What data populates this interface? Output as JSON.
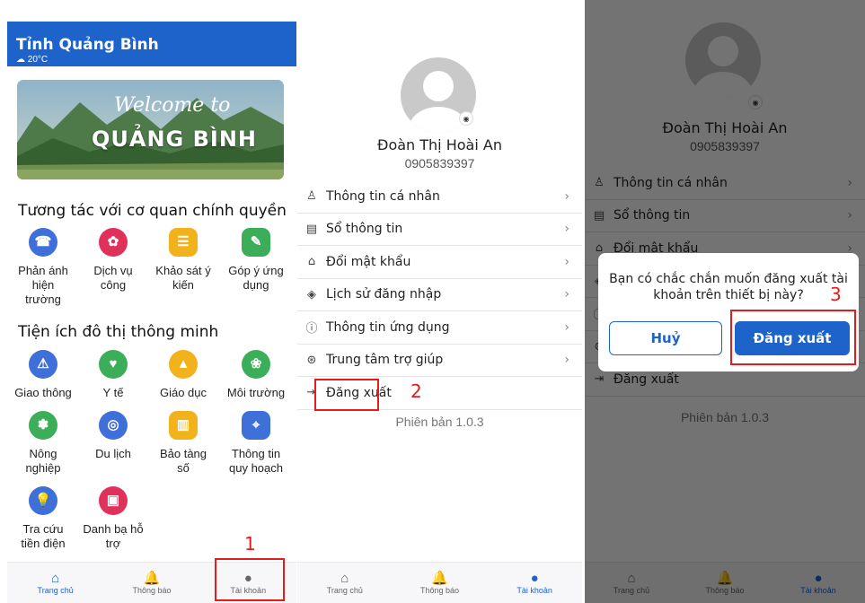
{
  "screen1": {
    "header_title": "Tỉnh Quảng Bình",
    "weather": "20°C",
    "banner_welcome": "Welcome to",
    "banner_place": "QUẢNG BÌNH",
    "section1_title": "Tương tác với cơ quan chính quyền",
    "section1_items": [
      {
        "label": "Phản ánh hiện trường",
        "icon": "megaphone-icon",
        "color": "#3f6fd8"
      },
      {
        "label": "Dịch vụ công",
        "icon": "public-service-icon",
        "color": "#e0315a"
      },
      {
        "label": "Khảo sát ý kiến",
        "icon": "survey-icon",
        "color": "#f2b21c"
      },
      {
        "label": "Góp ý ứng dụng",
        "icon": "feedback-icon",
        "color": "#3cae5a"
      }
    ],
    "section2_title": "Tiện ích đô thị thông minh",
    "section2_items": [
      {
        "label": "Giao thông",
        "icon": "traffic-icon",
        "color": "#3f6fd8"
      },
      {
        "label": "Y tế",
        "icon": "health-icon",
        "color": "#3cae5a"
      },
      {
        "label": "Giáo dục",
        "icon": "education-icon",
        "color": "#f2b21c"
      },
      {
        "label": "Môi trường",
        "icon": "environment-icon",
        "color": "#3cae5a"
      },
      {
        "label": "Nông nghiệp",
        "icon": "agriculture-icon",
        "color": "#3cae5a"
      },
      {
        "label": "Du lịch",
        "icon": "travel-icon",
        "color": "#3f6fd8"
      },
      {
        "label": "Bảo tàng số",
        "icon": "museum-icon",
        "color": "#f2b21c"
      },
      {
        "label": "Thông tin quy hoạch",
        "icon": "map-icon",
        "color": "#3f6fd8"
      },
      {
        "label": "Tra cứu tiền điện",
        "icon": "electricity-icon",
        "color": "#3f6fd8"
      },
      {
        "label": "Danh bạ hỗ trợ",
        "icon": "contacts-icon",
        "color": "#e0315a"
      }
    ],
    "step_number": "1"
  },
  "nav": {
    "home": "Trang chủ",
    "notifications": "Thông báo",
    "account": "Tài khoản"
  },
  "profile": {
    "name": "Đoàn Thị Hoài An",
    "phone": "0905839397",
    "menu": [
      "Thông tin cá nhân",
      "Sổ thông tin",
      "Đổi mật khẩu",
      "Lịch sử đăng nhập",
      "Thông tin ứng dụng",
      "Trung tâm trợ giúp"
    ],
    "logout": "Đăng xuất",
    "version": "Phiên bản 1.0.3",
    "step_number": "2"
  },
  "dialog": {
    "question": "Bạn có chắc chắn muốn đăng xuất tài khoản trên thiết bị này?",
    "cancel": "Huỷ",
    "confirm": "Đăng xuất",
    "step_number": "3"
  },
  "colors": {
    "primary": "#1e63c9",
    "highlight": "#e61b1b"
  }
}
